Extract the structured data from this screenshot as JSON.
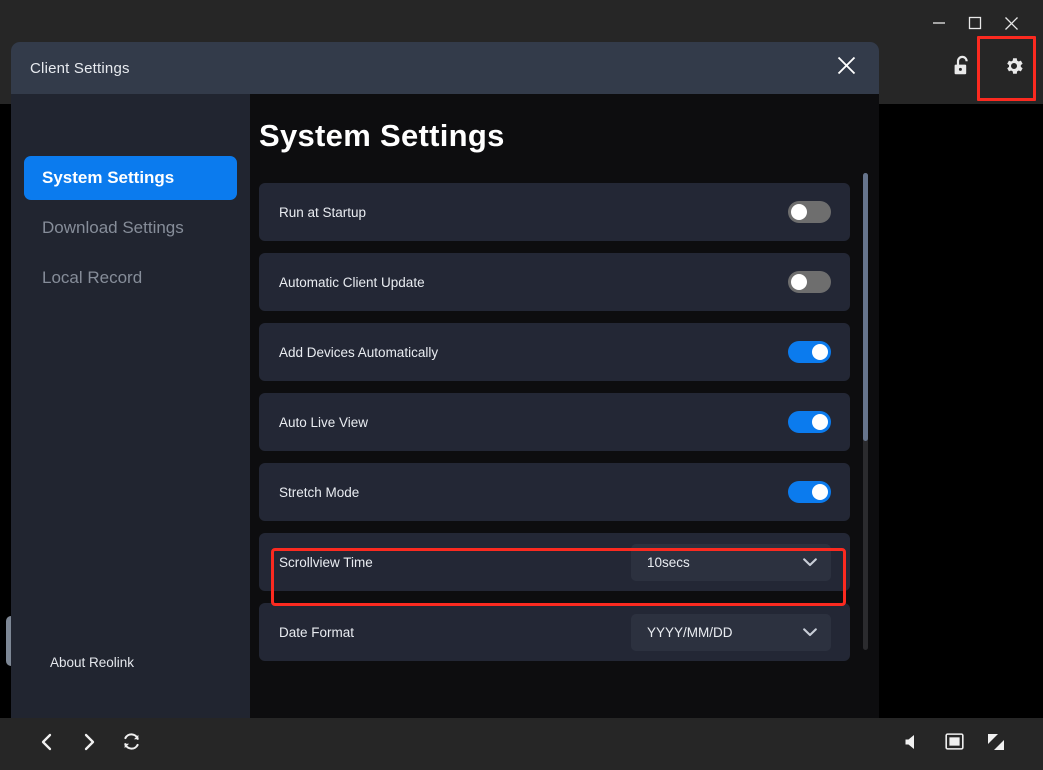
{
  "window": {
    "controls": [
      {
        "name": "minimize",
        "glyph": "minimize-icon"
      },
      {
        "name": "maximize",
        "glyph": "maximize-icon"
      },
      {
        "name": "close",
        "glyph": "close-icon"
      }
    ],
    "tools": [
      {
        "name": "unlock-icon",
        "label": "Unlock"
      },
      {
        "name": "gear-icon",
        "label": "Settings"
      }
    ]
  },
  "dialog": {
    "title": "Client Settings",
    "close_label": "✕"
  },
  "sidebar": {
    "items": [
      {
        "label": "System Settings",
        "active": true
      },
      {
        "label": "Download Settings",
        "active": false
      },
      {
        "label": "Local Record",
        "active": false
      }
    ],
    "about_label": "About Reolink"
  },
  "panel": {
    "title": "System Settings",
    "rows": [
      {
        "label": "Run at Startup",
        "control": "toggle",
        "value": "off"
      },
      {
        "label": "Automatic Client Update",
        "control": "toggle",
        "value": "off"
      },
      {
        "label": "Add Devices Automatically",
        "control": "toggle",
        "value": "on"
      },
      {
        "label": "Auto Live View",
        "control": "toggle",
        "value": "on"
      },
      {
        "label": "Stretch Mode",
        "control": "toggle",
        "value": "on"
      },
      {
        "label": "Scrollview Time",
        "control": "dropdown",
        "value": "10secs",
        "highlighted": true
      },
      {
        "label": "Date Format",
        "control": "dropdown",
        "value": "YYYY/MM/DD",
        "highlighted": false
      }
    ]
  },
  "bottom_bar": {
    "left_buttons": [
      {
        "name": "previous-icon",
        "label": "Previous"
      },
      {
        "name": "next-icon",
        "label": "Next"
      },
      {
        "name": "refresh-icon",
        "label": "Refresh"
      }
    ],
    "right_buttons": [
      {
        "name": "volume-icon",
        "label": "Volume"
      },
      {
        "name": "snapshot-icon",
        "label": "Snapshot"
      },
      {
        "name": "fullscreen-icon",
        "label": "Fullscreen"
      }
    ]
  },
  "colors": {
    "accent": "#0b7bee",
    "highlight": "#fb2a20",
    "dialog_header": "#333b4a",
    "dialog_body": "#212530",
    "row_bg": "#232735",
    "panel_bg": "#0d0d0f"
  }
}
